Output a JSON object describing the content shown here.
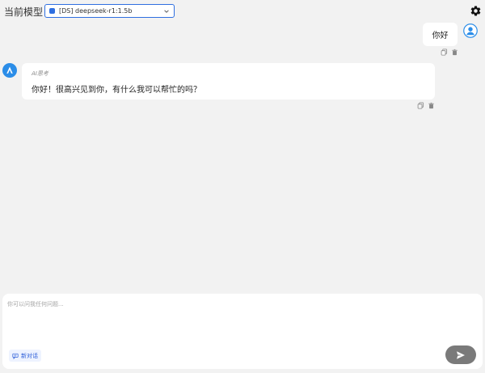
{
  "header": {
    "model_label": "当前模型：",
    "selected_model": "[DS] deepseek-r1:1.5b"
  },
  "messages": {
    "user": {
      "text": "你好"
    },
    "ai": {
      "thinking_label": "AI思考",
      "text": "你好！很高兴见到你，有什么我可以帮忙的吗？"
    }
  },
  "composer": {
    "placeholder": "你可以问我任何问题...",
    "new_chat_label": "新对话"
  },
  "colors": {
    "accent": "#2f6fe0",
    "background": "#f2f2f2",
    "send_button": "#7a7a7a"
  }
}
